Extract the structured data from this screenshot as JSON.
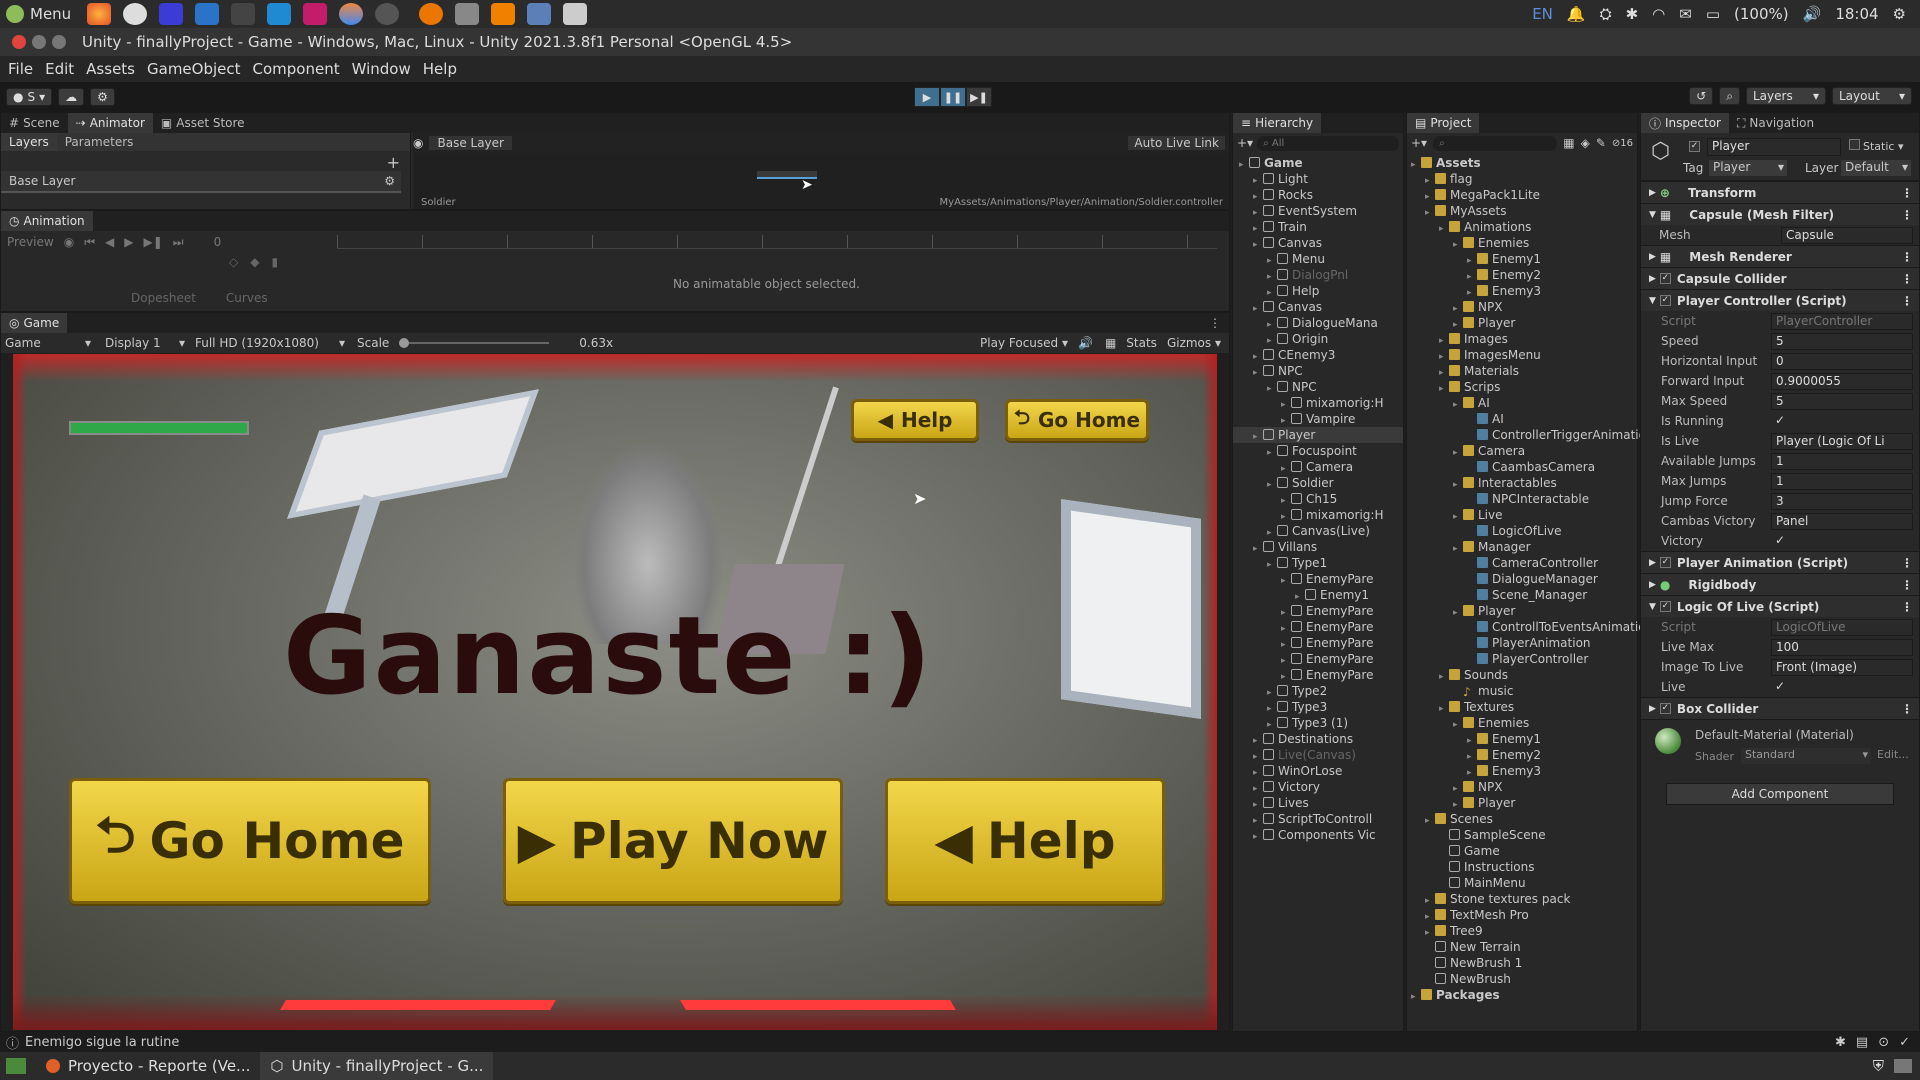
{
  "os_panel": {
    "menu_label": "Menu",
    "lang": "EN",
    "battery": "(100%)",
    "clock": "18:04"
  },
  "window": {
    "title": "Unity - finallyProject - Game - Windows, Mac, Linux - Unity 2021.3.8f1 Personal <OpenGL 4.5>"
  },
  "menu": [
    "File",
    "Edit",
    "Assets",
    "GameObject",
    "Component",
    "Window",
    "Help"
  ],
  "toolbar": {
    "account": "S",
    "layers": "Layers",
    "layout": "Layout"
  },
  "scene_tabs": [
    "Scene",
    "Animator",
    "Asset Store"
  ],
  "animator": {
    "sub_tabs": [
      "Layers",
      "Parameters"
    ],
    "breadcrumb": "Base Layer",
    "auto_live_link": "Auto Live Link",
    "layer_name": "Base Layer",
    "node": "Soldier",
    "path": "MyAssets/Animations/Player/Animation/Soldier.controller"
  },
  "animation": {
    "title": "Animation",
    "preview": "Preview",
    "frame": "0",
    "empty_msg": "No animatable object selected.",
    "tabs": [
      "Dopesheet",
      "Curves"
    ]
  },
  "game": {
    "tab": "Game",
    "display_mode": "Game",
    "display": "Display 1",
    "resolution": "Full HD (1920x1080)",
    "scale_label": "Scale",
    "scale_value": "0.63x",
    "play_mode": "Play Focused",
    "stats": "Stats",
    "gizmos": "Gizmos",
    "win_text": "Ganaste :)",
    "btn_help_small": "Help",
    "btn_home_small": "Go Home",
    "btn_home": "Go Home",
    "btn_play": "Play Now",
    "btn_help": "Help"
  },
  "hierarchy": {
    "title": "Hierarchy",
    "search": "All",
    "items": [
      {
        "t": "Game",
        "d": 0,
        "k": "scene"
      },
      {
        "t": "Light",
        "d": 1
      },
      {
        "t": "Rocks",
        "d": 1
      },
      {
        "t": "EventSystem",
        "d": 1
      },
      {
        "t": "Train",
        "d": 1
      },
      {
        "t": "Canvas",
        "d": 1
      },
      {
        "t": "Menu",
        "d": 2
      },
      {
        "t": "DialogPnl",
        "d": 2,
        "dim": true
      },
      {
        "t": "Help",
        "d": 2
      },
      {
        "t": "Canvas",
        "d": 1
      },
      {
        "t": "DialogueMana",
        "d": 2
      },
      {
        "t": "Origin",
        "d": 2
      },
      {
        "t": "CEnemy3",
        "d": 1
      },
      {
        "t": "NPC",
        "d": 1
      },
      {
        "t": "NPC",
        "d": 2
      },
      {
        "t": "mixamorig:H",
        "d": 3
      },
      {
        "t": "Vampire",
        "d": 3
      },
      {
        "t": "Player",
        "d": 1,
        "sel": true
      },
      {
        "t": "Focuspoint",
        "d": 2
      },
      {
        "t": "Camera",
        "d": 3
      },
      {
        "t": "Soldier",
        "d": 2
      },
      {
        "t": "Ch15",
        "d": 3
      },
      {
        "t": "mixamorig:H",
        "d": 3
      },
      {
        "t": "Canvas(Live)",
        "d": 2
      },
      {
        "t": "Villans",
        "d": 1
      },
      {
        "t": "Type1",
        "d": 2
      },
      {
        "t": "EnemyPare",
        "d": 3
      },
      {
        "t": "Enemy1",
        "d": 4
      },
      {
        "t": "EnemyPare",
        "d": 3
      },
      {
        "t": "EnemyPare",
        "d": 3
      },
      {
        "t": "EnemyPare",
        "d": 3
      },
      {
        "t": "EnemyPare",
        "d": 3
      },
      {
        "t": "EnemyPare",
        "d": 3
      },
      {
        "t": "Type2",
        "d": 2
      },
      {
        "t": "Type3",
        "d": 2
      },
      {
        "t": "Type3 (1)",
        "d": 2
      },
      {
        "t": "Destinations",
        "d": 1
      },
      {
        "t": "Live(Canvas)",
        "d": 1,
        "dim": true
      },
      {
        "t": "WinOrLose",
        "d": 1
      },
      {
        "t": "Victory",
        "d": 1
      },
      {
        "t": "Lives",
        "d": 1
      },
      {
        "t": "ScriptToControll",
        "d": 1
      },
      {
        "t": "Components Vic",
        "d": 1
      }
    ]
  },
  "project": {
    "title": "Project",
    "count": "16",
    "items": [
      {
        "t": "Assets",
        "d": 0,
        "k": "folder",
        "b": true
      },
      {
        "t": "flag",
        "d": 1,
        "k": "folder"
      },
      {
        "t": "MegaPack1Lite",
        "d": 1,
        "k": "folder"
      },
      {
        "t": "MyAssets",
        "d": 1,
        "k": "folder"
      },
      {
        "t": "Animations",
        "d": 2,
        "k": "folder"
      },
      {
        "t": "Enemies",
        "d": 3,
        "k": "folder"
      },
      {
        "t": "Enemy1",
        "d": 4,
        "k": "folder"
      },
      {
        "t": "Enemy2",
        "d": 4,
        "k": "folder"
      },
      {
        "t": "Enemy3",
        "d": 4,
        "k": "folder"
      },
      {
        "t": "NPX",
        "d": 3,
        "k": "folder"
      },
      {
        "t": "Player",
        "d": 3,
        "k": "folder"
      },
      {
        "t": "Images",
        "d": 2,
        "k": "folder"
      },
      {
        "t": "ImagesMenu",
        "d": 2,
        "k": "folder"
      },
      {
        "t": "Materials",
        "d": 2,
        "k": "folder"
      },
      {
        "t": "Scrips",
        "d": 2,
        "k": "folder"
      },
      {
        "t": "AI",
        "d": 3,
        "k": "folder"
      },
      {
        "t": "AI",
        "d": 4,
        "k": "script"
      },
      {
        "t": "ControllerTriggerAnimatio",
        "d": 4,
        "k": "script"
      },
      {
        "t": "Camera",
        "d": 3,
        "k": "folder"
      },
      {
        "t": "CaambasCamera",
        "d": 4,
        "k": "script"
      },
      {
        "t": "Interactables",
        "d": 3,
        "k": "folder"
      },
      {
        "t": "NPCInteractable",
        "d": 4,
        "k": "script"
      },
      {
        "t": "Live",
        "d": 3,
        "k": "folder"
      },
      {
        "t": "LogicOfLive",
        "d": 4,
        "k": "script"
      },
      {
        "t": "Manager",
        "d": 3,
        "k": "folder"
      },
      {
        "t": "CameraController",
        "d": 4,
        "k": "script"
      },
      {
        "t": "DialogueManager",
        "d": 4,
        "k": "script"
      },
      {
        "t": "Scene_Manager",
        "d": 4,
        "k": "script"
      },
      {
        "t": "Player",
        "d": 3,
        "k": "folder"
      },
      {
        "t": "ControllToEventsAnimatio",
        "d": 4,
        "k": "script"
      },
      {
        "t": "PlayerAnimation",
        "d": 4,
        "k": "script"
      },
      {
        "t": "PlayerController",
        "d": 4,
        "k": "script"
      },
      {
        "t": "Sounds",
        "d": 2,
        "k": "folder"
      },
      {
        "t": "music",
        "d": 3,
        "k": "audio"
      },
      {
        "t": "Textures",
        "d": 2,
        "k": "folder"
      },
      {
        "t": "Enemies",
        "d": 3,
        "k": "folder"
      },
      {
        "t": "Enemy1",
        "d": 4,
        "k": "folder"
      },
      {
        "t": "Enemy2",
        "d": 4,
        "k": "folder"
      },
      {
        "t": "Enemy3",
        "d": 4,
        "k": "folder"
      },
      {
        "t": "NPX",
        "d": 3,
        "k": "folder"
      },
      {
        "t": "Player",
        "d": 3,
        "k": "folder"
      },
      {
        "t": "Scenes",
        "d": 1,
        "k": "folder"
      },
      {
        "t": "SampleScene",
        "d": 2,
        "k": "scene"
      },
      {
        "t": "Game",
        "d": 2,
        "k": "scene"
      },
      {
        "t": "Instructions",
        "d": 2,
        "k": "scene"
      },
      {
        "t": "MainMenu",
        "d": 2,
        "k": "scene"
      },
      {
        "t": "Stone textures pack",
        "d": 1,
        "k": "folder"
      },
      {
        "t": "TextMesh Pro",
        "d": 1,
        "k": "folder"
      },
      {
        "t": "Tree9",
        "d": 1,
        "k": "folder"
      },
      {
        "t": "New Terrain",
        "d": 1,
        "k": "terrain"
      },
      {
        "t": "NewBrush 1",
        "d": 1,
        "k": "terrain"
      },
      {
        "t": "NewBrush",
        "d": 1,
        "k": "terrain"
      },
      {
        "t": "Packages",
        "d": 0,
        "k": "folder",
        "b": true
      }
    ]
  },
  "inspector": {
    "title": "Inspector",
    "nav_tab": "Navigation",
    "object_name": "Player",
    "static_label": "Static",
    "tag_label": "Tag",
    "tag": "Player",
    "layer_label": "Layer",
    "layer": "Default",
    "transform": "Transform",
    "mesh_filter": "Capsule (Mesh Filter)",
    "mesh_label": "Mesh",
    "mesh_value": "Capsule",
    "mesh_renderer": "Mesh Renderer",
    "capsule_collider": "Capsule Collider",
    "player_controller": "Player Controller (Script)",
    "pc_fields": [
      [
        "Script",
        "PlayerController"
      ],
      [
        "Speed",
        "5"
      ],
      [
        "Horizontal Input",
        "0"
      ],
      [
        "Forward Input",
        "0.9000055"
      ],
      [
        "Max Speed",
        "5"
      ],
      [
        "Is Running",
        "✓"
      ],
      [
        "Is Live",
        "Player (Logic Of Li"
      ],
      [
        "Available Jumps",
        "1"
      ],
      [
        "Max Jumps",
        "1"
      ],
      [
        "Jump Force",
        "3"
      ],
      [
        "Cambas Victory",
        "Panel"
      ],
      [
        "Victory",
        "✓"
      ]
    ],
    "player_animation": "Player Animation (Script)",
    "rigidbody": "Rigidbody",
    "logic_of_live": "Logic Of Live (Script)",
    "lol_fields": [
      [
        "Script",
        "LogicOfLive"
      ],
      [
        "Live Max",
        "100"
      ],
      [
        "Image To Live",
        "Front (Image)"
      ],
      [
        "Live",
        "✓"
      ]
    ],
    "box_collider": "Box Collider",
    "material": "Default-Material (Material)",
    "shader_label": "Shader",
    "shader": "Standard",
    "edit": "Edit...",
    "add_component": "Add Component"
  },
  "status": {
    "message": "Enemigo sigue la rutine"
  },
  "taskbar": {
    "item1": "Proyecto - Reporte (Ve...",
    "item2": "Unity - finallyProject - G..."
  }
}
